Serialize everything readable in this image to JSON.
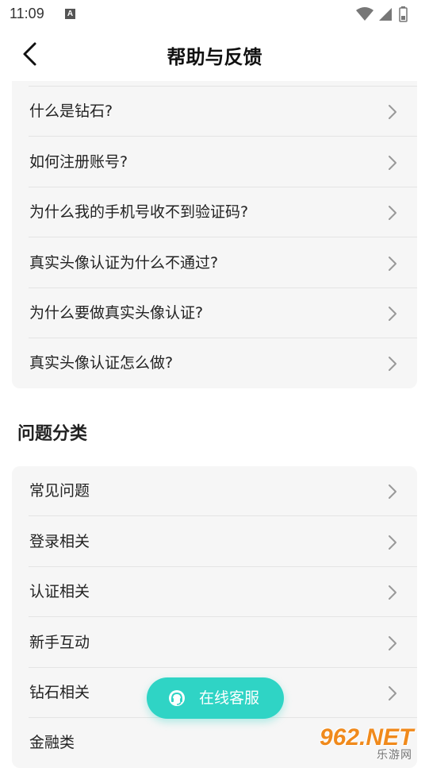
{
  "status_bar": {
    "time": "11:09",
    "notification_letter": "A",
    "icons": [
      "wifi-icon",
      "signal-icon",
      "battery-icon"
    ]
  },
  "header": {
    "title": "帮助与反馈",
    "back_icon": "chevron-left-icon"
  },
  "faq": {
    "items": [
      {
        "label": "什么是钻石?"
      },
      {
        "label": "如何注册账号?"
      },
      {
        "label": "为什么我的手机号收不到验证码?"
      },
      {
        "label": "真实头像认证为什么不通过?"
      },
      {
        "label": "为什么要做真实头像认证?"
      },
      {
        "label": "真实头像认证怎么做?"
      }
    ]
  },
  "categories": {
    "title": "问题分类",
    "items": [
      {
        "label": "常见问题"
      },
      {
        "label": "登录相关"
      },
      {
        "label": "认证相关"
      },
      {
        "label": "新手互动"
      },
      {
        "label": "钻石相关"
      },
      {
        "label": "金融类"
      }
    ]
  },
  "fab": {
    "label": "在线客服",
    "icon": "headset-icon"
  },
  "watermark": {
    "main": "962.NET",
    "sub": "乐游网"
  },
  "colors": {
    "accent": "#2fd4c5",
    "card_bg": "#f6f6f6",
    "separator": "#e4e4e4",
    "watermark": "#f08a1c"
  }
}
